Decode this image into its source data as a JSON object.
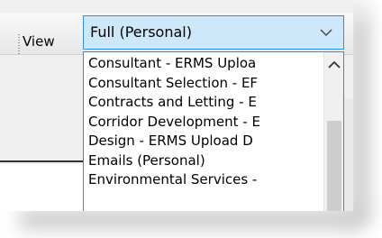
{
  "toolbar": {
    "view_label": "View",
    "view_select": {
      "value": "Full (Personal)",
      "expanded": true,
      "options": [
        "Consultant - ERMS Uploa",
        "Consultant Selection - EF",
        "Contracts and Letting - E",
        "Corridor Development - E",
        "Design - ERMS Upload D",
        "Emails (Personal)",
        "Environmental Services -"
      ]
    }
  },
  "icons": {
    "chevron": "chevron-down-icon",
    "scroll_up": "scroll-up-arrow-icon"
  },
  "colors": {
    "select_focus_border": "#2f8fe0",
    "select_focus_bg": "#cde8fb"
  }
}
